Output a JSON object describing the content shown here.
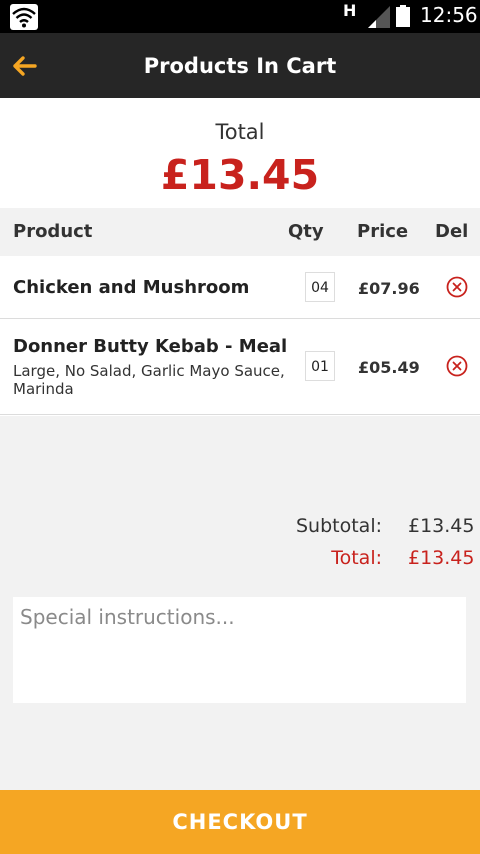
{
  "status_bar": {
    "time": "12:56",
    "network_type": "H",
    "icons": [
      "wifi-icon",
      "network-type-icon",
      "signal-icon",
      "battery-icon"
    ]
  },
  "app_bar": {
    "title": "Products In Cart",
    "back_icon": "back-arrow-icon",
    "accent_color": "#f5a623"
  },
  "total": {
    "label": "Total",
    "value": "£13.45",
    "color": "#c8221d"
  },
  "table": {
    "headers": {
      "product": "Product",
      "qty": "Qty",
      "price": "Price",
      "del": "Del"
    },
    "rows": [
      {
        "name": "Chicken and Mushroom",
        "options": "",
        "qty": "04",
        "price": "£07.96"
      },
      {
        "name": "Donner Butty Kebab - Meal",
        "options": "Large, No Salad, Garlic Mayo Sauce, Marinda",
        "qty": "01",
        "price": "£05.49"
      }
    ]
  },
  "summary": {
    "subtotal_label": "Subtotal:",
    "subtotal_value": "£13.45",
    "total_label": "Total:",
    "total_value": "£13.45"
  },
  "instructions": {
    "placeholder": "Special instructions...",
    "value": ""
  },
  "checkout": {
    "label": "CHECKOUT",
    "color": "#f5a623"
  }
}
